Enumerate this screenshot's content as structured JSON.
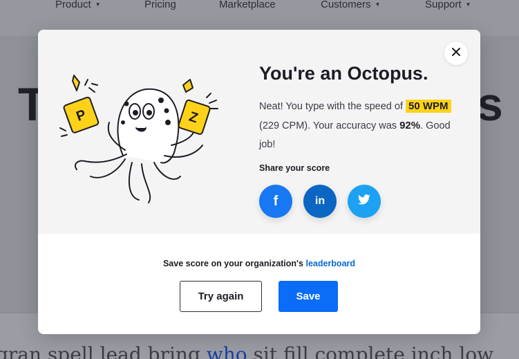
{
  "nav": {
    "items": [
      {
        "label": "Product",
        "has_caret": true
      },
      {
        "label": "Pricing",
        "has_caret": false
      },
      {
        "label": "Marketplace",
        "has_caret": false
      },
      {
        "label": "Customers",
        "has_caret": true
      },
      {
        "label": "Support",
        "has_caret": true
      }
    ],
    "caret": "▼"
  },
  "background": {
    "heading_left": "T",
    "heading_right": "s",
    "text_before": "gran spell lead bring ",
    "text_highlight": "who",
    "text_after": " sit fill complete inch low"
  },
  "modal": {
    "close_icon": "×",
    "title": "You're an Octopus.",
    "desc_part1": "Neat! You type with the speed of ",
    "wpm": "50 WPM",
    "desc_part2": " (229 CPM). Your accuracy was ",
    "accuracy": "92%",
    "desc_part3": ". Good job!",
    "share_label": "Share your score",
    "social": {
      "facebook": "f",
      "linkedin": "in",
      "twitter": "twitter-icon"
    },
    "save_text": "Save score on your organization's ",
    "save_link": "leaderboard",
    "try_again": "Try again",
    "save": "Save"
  },
  "colors": {
    "accent": "#0a6cf7",
    "highlight": "#ffd21a",
    "facebook": "#1877f2",
    "linkedin": "#0a66c2",
    "twitter": "#1da1f2"
  }
}
